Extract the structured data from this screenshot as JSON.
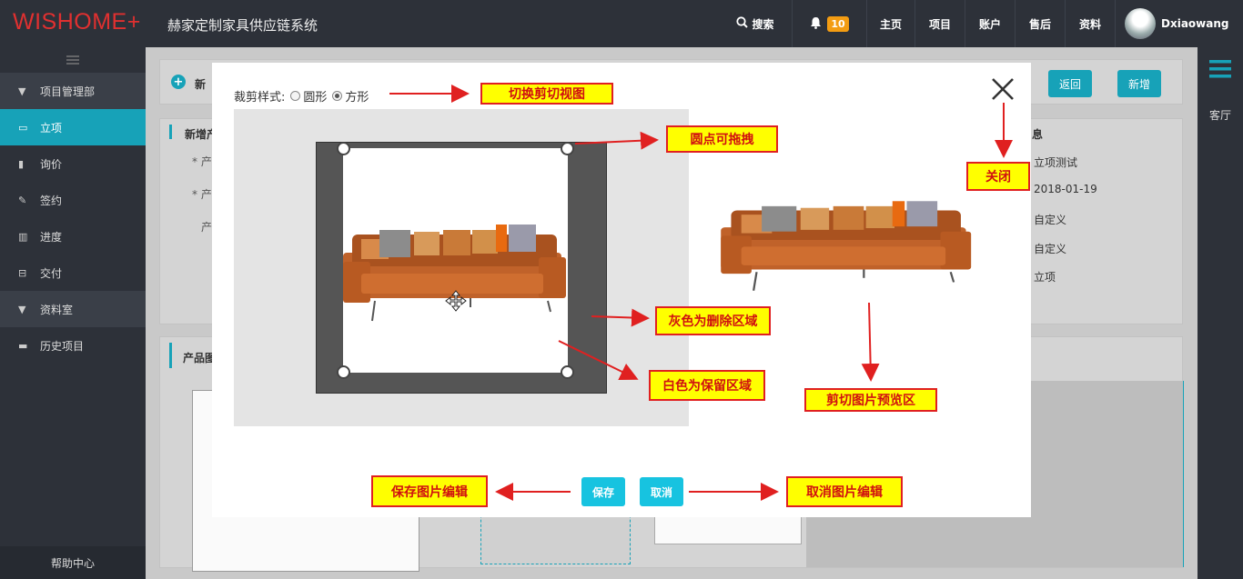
{
  "app": {
    "logo": "WISHOME+",
    "title": "赫家定制家具供应链系统"
  },
  "topnav": {
    "search_label": "搜索",
    "notification_count": "10",
    "items": [
      "主页",
      "项目",
      "账户",
      "售后",
      "资料"
    ],
    "username": "Dxiaowang"
  },
  "sidebar": {
    "items": [
      {
        "label": "项目管理部",
        "type": "group"
      },
      {
        "label": "立项",
        "type": "item",
        "active": true
      },
      {
        "label": "询价",
        "type": "item"
      },
      {
        "label": "签约",
        "type": "item"
      },
      {
        "label": "进度",
        "type": "item"
      },
      {
        "label": "交付",
        "type": "item"
      },
      {
        "label": "资料室",
        "type": "group"
      },
      {
        "label": "历史项目",
        "type": "item"
      }
    ],
    "help": "帮助中心"
  },
  "rightbar": {
    "label": "客厅"
  },
  "background": {
    "header_partial": "新",
    "back_button": "返回",
    "add_button": "新增",
    "panel_title_partial": "新增产",
    "info_title_partial": "息",
    "field_partials": [
      "* 产",
      "* 产",
      "产"
    ],
    "info_values": [
      "立项测试",
      "2018-01-19",
      "自定义",
      "自定义",
      "立项"
    ],
    "image_panel_title_partial": "产品图"
  },
  "modal": {
    "crop_style_label": "裁剪样式:",
    "options": [
      {
        "label": "圆形",
        "selected": false
      },
      {
        "label": "方形",
        "selected": true
      }
    ],
    "save_button": "保存",
    "cancel_button": "取消"
  },
  "annotations": {
    "switch_view": "切换剪切视图",
    "drag_dots": "圆点可拖拽",
    "close": "关闭",
    "gray_area": "灰色为删除区域",
    "white_area": "白色为保留区域",
    "preview_area": "剪切图片预览区",
    "save_edit": "保存图片编辑",
    "cancel_edit": "取消图片编辑"
  },
  "colors": {
    "accent": "#17a2b8",
    "annotation_bg": "#ffff00",
    "annotation_border": "#e02020",
    "logo": "#e03030"
  }
}
